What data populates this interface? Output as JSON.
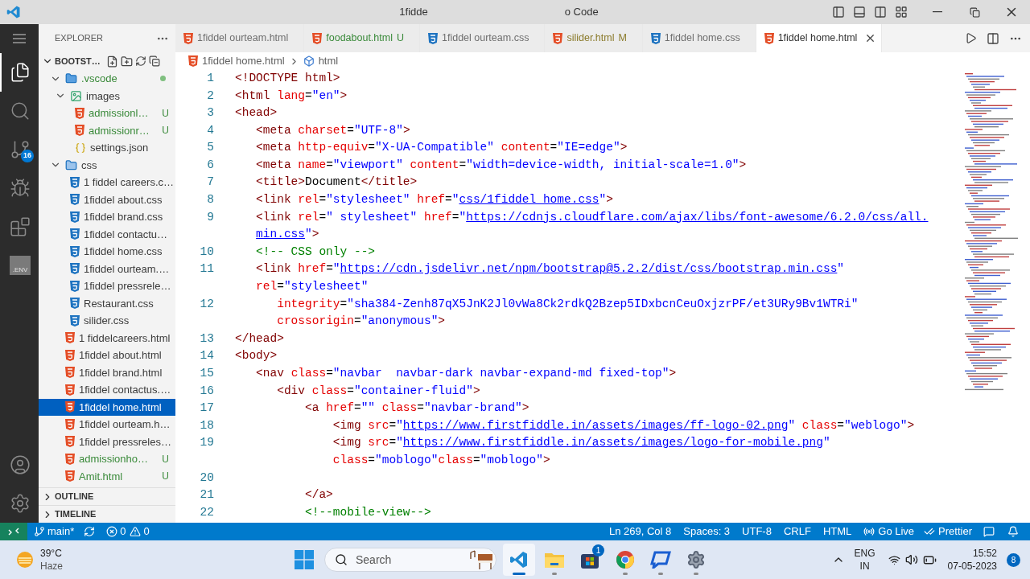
{
  "window": {
    "title_parts": [
      "1fidde",
      "o Code"
    ]
  },
  "activity_bar": [
    {
      "selected": true
    },
    {
      "selected": false
    },
    {
      "selected": false,
      "badge": "16"
    },
    {
      "selected": false
    },
    {
      "selected": false
    },
    {
      "selected": false,
      "label": ".ENV"
    },
    {
      "selected": false
    },
    {
      "selected": false
    }
  ],
  "sidebar": {
    "title": "EXPLORER",
    "root": {
      "label": "BOOTST…",
      "expanded": true
    },
    "items": [
      {
        "label": ".vscode",
        "kind": "vscode",
        "expanded": true,
        "color": "#3a8a3a",
        "dot": true,
        "selected": false,
        "children": [
          {
            "label": "images",
            "kind": "images",
            "expanded": true,
            "selected": false,
            "children": [
              {
                "label": "admissionl…",
                "kind": "html",
                "color": "#3a8a3a",
                "badge": "U",
                "selected": false
              },
              {
                "label": "admissionr…",
                "kind": "html",
                "color": "#3a8a3a",
                "badge": "U",
                "selected": false
              },
              {
                "label": "settings.json",
                "kind": "json",
                "selected": false
              }
            ]
          }
        ]
      },
      {
        "label": "css",
        "kind": "cssfolder",
        "expanded": true,
        "selected": false,
        "children": [
          {
            "label": "1 fiddel careers.c…",
            "kind": "css",
            "selected": false
          },
          {
            "label": "1fiddel about.css",
            "kind": "css",
            "selected": false
          },
          {
            "label": "1fiddel brand.css",
            "kind": "css",
            "selected": false
          },
          {
            "label": "1fiddel contactu…",
            "kind": "css",
            "selected": false
          },
          {
            "label": "1fiddel home.css",
            "kind": "css",
            "selected": false
          },
          {
            "label": "1fiddel ourteam.…",
            "kind": "css",
            "selected": false
          },
          {
            "label": "1fiddel pressrele…",
            "kind": "css",
            "selected": false
          },
          {
            "label": "Restaurant.css",
            "kind": "css",
            "selected": false
          },
          {
            "label": "silider.css",
            "kind": "css",
            "selected": false
          }
        ]
      },
      {
        "label": "1 fiddelcareers.html",
        "kind": "html",
        "selected": false
      },
      {
        "label": "1fiddel about.html",
        "kind": "html",
        "selected": false
      },
      {
        "label": "1fiddel brand.html",
        "kind": "html",
        "selected": false
      },
      {
        "label": "1fiddel contactus.…",
        "kind": "html",
        "selected": false
      },
      {
        "label": "1fiddel home.html",
        "kind": "html",
        "selected": true
      },
      {
        "label": "1fiddel ourteam.h…",
        "kind": "html",
        "selected": false
      },
      {
        "label": "1fiddel pressreles…",
        "kind": "html",
        "selected": false
      },
      {
        "label": "admissionho…",
        "kind": "html",
        "color": "#3a8a3a",
        "badge": "U",
        "selected": false
      },
      {
        "label": "Amit.html",
        "kind": "html",
        "color": "#3a8a3a",
        "badge": "U",
        "selected": false
      }
    ],
    "panels": [
      {
        "label": "OUTLINE",
        "expanded": false
      },
      {
        "label": "TIMELINE",
        "expanded": false
      }
    ]
  },
  "tabs": [
    {
      "label": "1fiddel ourteam.html",
      "kind": "html",
      "selected": false
    },
    {
      "label": "foodabout.html",
      "kind": "html",
      "color": "#3a8a3a",
      "badge": "U",
      "selected": false
    },
    {
      "label": "1fiddel ourteam.css",
      "kind": "css",
      "selected": false
    },
    {
      "label": "silider.html",
      "kind": "html",
      "color": "#8a7a2a",
      "badge": "M",
      "selected": false
    },
    {
      "label": "1fiddel home.css",
      "kind": "css",
      "selected": false
    },
    {
      "label": "1fiddel home.html",
      "kind": "html",
      "selected": true
    }
  ],
  "breadcrumb": [
    "1fiddel home.html",
    "html"
  ],
  "code_lines": [
    {
      "n": "1",
      "segs": [
        {
          "kind": "tag",
          "text": "<!DOCTYPE html>"
        }
      ]
    },
    {
      "n": "2",
      "segs": [
        {
          "kind": "tag",
          "text": "<html"
        },
        {
          "kind": "attr",
          "text": " lang"
        },
        {
          "kind": "plain",
          "text": "="
        },
        {
          "kind": "str",
          "text": "\"en\""
        },
        {
          "kind": "tag",
          "text": ">"
        }
      ]
    },
    {
      "n": "3",
      "segs": [
        {
          "kind": "tag",
          "text": "<head>"
        }
      ]
    },
    {
      "n": "4",
      "segs": [
        {
          "kind": "tag",
          "text": "   <meta"
        },
        {
          "kind": "attr",
          "text": " charset"
        },
        {
          "kind": "plain",
          "text": "="
        },
        {
          "kind": "str",
          "text": "\"UTF-8\""
        },
        {
          "kind": "tag",
          "text": ">"
        }
      ]
    },
    {
      "n": "5",
      "segs": [
        {
          "kind": "tag",
          "text": "   <meta"
        },
        {
          "kind": "attr",
          "text": " http-equiv"
        },
        {
          "kind": "plain",
          "text": "="
        },
        {
          "kind": "str",
          "text": "\"X-UA-Compatible\""
        },
        {
          "kind": "attr",
          "text": " content"
        },
        {
          "kind": "plain",
          "text": "="
        },
        {
          "kind": "str",
          "text": "\"IE=edge\""
        },
        {
          "kind": "tag",
          "text": ">"
        }
      ]
    },
    {
      "n": "6",
      "segs": [
        {
          "kind": "tag",
          "text": "   <meta"
        },
        {
          "kind": "attr",
          "text": " name"
        },
        {
          "kind": "plain",
          "text": "="
        },
        {
          "kind": "str",
          "text": "\"viewport\""
        },
        {
          "kind": "attr",
          "text": " content"
        },
        {
          "kind": "plain",
          "text": "="
        },
        {
          "kind": "str",
          "text": "\"width=device-width, initial-scale=1.0\""
        },
        {
          "kind": "tag",
          "text": ">"
        }
      ]
    },
    {
      "n": "7",
      "segs": [
        {
          "kind": "tag",
          "text": "   <title>"
        },
        {
          "kind": "plain",
          "text": "Document"
        },
        {
          "kind": "tag",
          "text": "</title>"
        }
      ]
    },
    {
      "n": "8",
      "segs": [
        {
          "kind": "tag",
          "text": "   <link"
        },
        {
          "kind": "attr",
          "text": " rel"
        },
        {
          "kind": "plain",
          "text": "="
        },
        {
          "kind": "str",
          "text": "\"stylesheet\""
        },
        {
          "kind": "attr",
          "text": " href"
        },
        {
          "kind": "plain",
          "text": "="
        },
        {
          "kind": "str",
          "text": "\""
        },
        {
          "kind": "url",
          "text": "css/1fiddel home.css"
        },
        {
          "kind": "str",
          "text": "\""
        },
        {
          "kind": "tag",
          "text": ">"
        }
      ]
    },
    {
      "n": "9",
      "segs": [
        {
          "kind": "tag",
          "text": "   <link"
        },
        {
          "kind": "attr",
          "text": " rel"
        },
        {
          "kind": "plain",
          "text": "="
        },
        {
          "kind": "str",
          "text": "\" stylesheet\""
        },
        {
          "kind": "attr",
          "text": " href"
        },
        {
          "kind": "plain",
          "text": "="
        },
        {
          "kind": "str",
          "text": "\""
        },
        {
          "kind": "url",
          "text": "https://cdnjs.cloudflare.com/ajax/libs/font-awesome/6.2.0/css/all."
        }
      ]
    },
    {
      "segs": [
        {
          "kind": "url",
          "text": "   min.css"
        },
        {
          "kind": "str",
          "text": "\""
        },
        {
          "kind": "tag",
          "text": ">"
        }
      ]
    },
    {
      "n": "10",
      "segs": [
        {
          "kind": "comment",
          "text": "   <!-- CSS only -->"
        }
      ]
    },
    {
      "n": "11",
      "segs": [
        {
          "kind": "tag",
          "text": "   <link"
        },
        {
          "kind": "attr",
          "text": " href"
        },
        {
          "kind": "plain",
          "text": "="
        },
        {
          "kind": "str",
          "text": "\""
        },
        {
          "kind": "url",
          "text": "https://cdn.jsdelivr.net/npm/bootstrap@5.2.2/dist/css/bootstrap.min.css"
        },
        {
          "kind": "str",
          "text": "\""
        }
      ]
    },
    {
      "segs": [
        {
          "kind": "attr",
          "text": "   rel"
        },
        {
          "kind": "plain",
          "text": "="
        },
        {
          "kind": "str",
          "text": "\"stylesheet\""
        }
      ]
    },
    {
      "n": "12",
      "segs": [
        {
          "kind": "attr",
          "text": "      integrity"
        },
        {
          "kind": "plain",
          "text": "="
        },
        {
          "kind": "str",
          "text": "\"sha384-Zenh87qX5JnK2Jl0vWa8Ck2rdkQ2Bzep5IDxbcnCeuOxjzrPF/et3URy9Bv1WTRi\""
        }
      ]
    },
    {
      "segs": [
        {
          "kind": "attr",
          "text": "      crossorigin"
        },
        {
          "kind": "plain",
          "text": "="
        },
        {
          "kind": "str",
          "text": "\"anonymous\""
        },
        {
          "kind": "tag",
          "text": ">"
        }
      ]
    },
    {
      "n": "13",
      "segs": [
        {
          "kind": "tag",
          "text": "</head>"
        }
      ]
    },
    {
      "n": "14",
      "segs": [
        {
          "kind": "tag",
          "text": "<body>"
        }
      ]
    },
    {
      "n": "15",
      "segs": [
        {
          "kind": "tag",
          "text": "   <nav"
        },
        {
          "kind": "attr",
          "text": " class"
        },
        {
          "kind": "plain",
          "text": "="
        },
        {
          "kind": "str",
          "text": "\"navbar  navbar-dark navbar-expand-md fixed-top\""
        },
        {
          "kind": "tag",
          "text": ">"
        }
      ]
    },
    {
      "n": "16",
      "segs": [
        {
          "kind": "tag",
          "text": "      <div"
        },
        {
          "kind": "attr",
          "text": " class"
        },
        {
          "kind": "plain",
          "text": "="
        },
        {
          "kind": "str",
          "text": "\"container-fluid\""
        },
        {
          "kind": "tag",
          "text": ">"
        }
      ]
    },
    {
      "n": "17",
      "segs": [
        {
          "kind": "tag",
          "text": "          <a"
        },
        {
          "kind": "attr",
          "text": " href"
        },
        {
          "kind": "plain",
          "text": "="
        },
        {
          "kind": "str",
          "text": "\"\""
        },
        {
          "kind": "attr",
          "text": " class"
        },
        {
          "kind": "plain",
          "text": "="
        },
        {
          "kind": "str",
          "text": "\"navbar-brand\""
        },
        {
          "kind": "tag",
          "text": ">"
        }
      ]
    },
    {
      "n": "18",
      "segs": [
        {
          "kind": "tag",
          "text": "              <img"
        },
        {
          "kind": "attr",
          "text": " src"
        },
        {
          "kind": "plain",
          "text": "="
        },
        {
          "kind": "str",
          "text": "\""
        },
        {
          "kind": "url",
          "text": "https://www.firstfiddle.in/assets/images/ff-logo-02.png"
        },
        {
          "kind": "str",
          "text": "\""
        },
        {
          "kind": "attr",
          "text": " class"
        },
        {
          "kind": "plain",
          "text": "="
        },
        {
          "kind": "str",
          "text": "\"weblogo\""
        },
        {
          "kind": "tag",
          "text": ">"
        }
      ]
    },
    {
      "n": "19",
      "segs": [
        {
          "kind": "tag",
          "text": "              <img"
        },
        {
          "kind": "attr",
          "text": " src"
        },
        {
          "kind": "plain",
          "text": "="
        },
        {
          "kind": "str",
          "text": "\""
        },
        {
          "kind": "url",
          "text": "https://www.firstfiddle.in/assets/images/logo-for-mobile.png"
        },
        {
          "kind": "str",
          "text": "\""
        }
      ]
    },
    {
      "segs": [
        {
          "kind": "attr",
          "text": "              class"
        },
        {
          "kind": "plain",
          "text": "="
        },
        {
          "kind": "str",
          "text": "\"moblogo\""
        },
        {
          "kind": "attr",
          "text": "class"
        },
        {
          "kind": "plain",
          "text": "="
        },
        {
          "kind": "str",
          "text": "\"moblogo\""
        },
        {
          "kind": "tag",
          "text": ">"
        }
      ]
    },
    {
      "n": "20"
    },
    {
      "n": "21",
      "segs": [
        {
          "kind": "tag",
          "text": "          </a>"
        }
      ]
    },
    {
      "n": "22",
      "segs": [
        {
          "kind": "comment",
          "text": "          <!--mobile-view-->"
        }
      ]
    }
  ],
  "status_bar": {
    "branch": "main*",
    "errors": "0",
    "warnings": "0",
    "right": [
      "Ln 269, Col 8",
      "Spaces: 3",
      "UTF-8",
      "CRLF",
      "HTML"
    ],
    "go_live": "Go Live",
    "prettier": "Prettier"
  },
  "taskbar": {
    "weather": {
      "temp": "39°C",
      "condition": "Haze"
    },
    "search": {
      "placeholder": "Search"
    },
    "apps": [
      {
        "active": true,
        "running": true
      },
      {
        "active": false,
        "running": true
      },
      {
        "active": false,
        "running": false,
        "badge": "1"
      },
      {
        "active": false,
        "running": true
      },
      {
        "active": false,
        "running": true
      },
      {
        "active": false,
        "running": true
      }
    ],
    "lang": [
      "ENG",
      "IN"
    ],
    "time": "15:52",
    "date": "07-05-2023",
    "notifications": "8"
  }
}
